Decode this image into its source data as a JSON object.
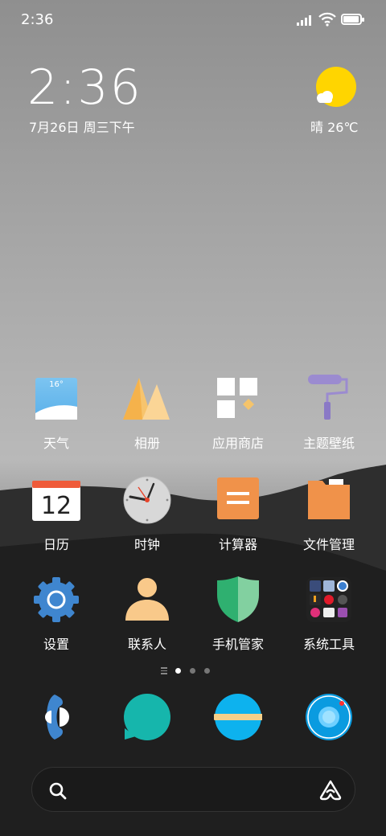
{
  "status_bar": {
    "time": "2:36",
    "icons": [
      "signal-icon",
      "wifi-icon",
      "battery-icon"
    ],
    "battery_level": 0.95
  },
  "clock_widget": {
    "time": "2:36",
    "date": "7月26日 周三下午"
  },
  "weather_widget": {
    "icon": "sunny-partly-cloudy-icon",
    "text": "晴 26℃"
  },
  "apps": [
    {
      "label": "天气",
      "icon": "weather-app-icon",
      "badge_text": "16°"
    },
    {
      "label": "相册",
      "icon": "gallery-icon"
    },
    {
      "label": "应用商店",
      "icon": "app-store-icon"
    },
    {
      "label": "主题壁纸",
      "icon": "themes-icon"
    },
    {
      "label": "日历",
      "icon": "calendar-icon",
      "badge_text": "12"
    },
    {
      "label": "时钟",
      "icon": "clock-icon"
    },
    {
      "label": "计算器",
      "icon": "calculator-icon"
    },
    {
      "label": "文件管理",
      "icon": "file-manager-icon"
    },
    {
      "label": "设置",
      "icon": "settings-icon"
    },
    {
      "label": "联系人",
      "icon": "contacts-icon"
    },
    {
      "label": "手机管家",
      "icon": "security-icon"
    },
    {
      "label": "系统工具",
      "icon": "tools-folder-icon"
    }
  ],
  "page_indicator": {
    "pages": 3,
    "current": 1
  },
  "dock": [
    {
      "icon": "phone-icon"
    },
    {
      "icon": "messages-icon"
    },
    {
      "icon": "browser-icon"
    },
    {
      "icon": "camera-icon"
    }
  ],
  "search_bar": {
    "left_icon": "search-icon",
    "right_icon": "assistant-icon"
  },
  "colors": {
    "weather_sun": "#ffd500",
    "orange": "#f0924a",
    "blue": "#3f86cf",
    "green": "#2fb070",
    "teal": "#16b6ac",
    "sky": "#0db2ee"
  }
}
